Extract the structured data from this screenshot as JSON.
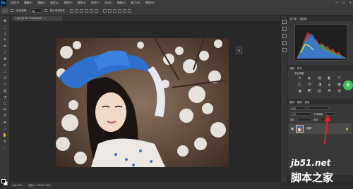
{
  "app": {
    "logo": "Ps"
  },
  "menu": {
    "items": [
      "文件(F)",
      "编辑(E)",
      "图像(I)",
      "图层(L)",
      "类型(Y)",
      "选择(S)",
      "滤镜(T)",
      "3D(D)",
      "视图(V)",
      "窗口(W)",
      "帮助(H)"
    ]
  },
  "window_controls": {
    "minimize": "—",
    "maximize": "□",
    "close": "✕"
  },
  "options_bar": {
    "auto_select_label": "自动选择:",
    "auto_select_value": "组",
    "show_transform_label": "显示变换控件"
  },
  "document_tab": {
    "title": "1.jpg @ 66.7%(RGB/8)",
    "close": "×"
  },
  "status_bar": {
    "zoom": "66.67%",
    "doc_size": "文档:1.10M/1.10M"
  },
  "float_icon": "⊞",
  "adjustments": {
    "title": "添加调整",
    "icons": [
      "☀",
      "◐",
      "▨",
      "◧",
      "▽",
      "◫",
      "⚖",
      "◨",
      "◭",
      "▦",
      "◪",
      "◩",
      "▤",
      "◓",
      "▥"
    ]
  },
  "layers": {
    "tabs": [
      "图层",
      "通道",
      "路径"
    ],
    "kind_filter": "类型",
    "blend_mode": "正常",
    "opacity_label": "不透明度",
    "lock_label": "锁定",
    "fill_label": "填充",
    "row": {
      "name": "背景",
      "eye": "◉",
      "lock": "🔒"
    }
  },
  "histogram_tabs": [
    "直方图",
    "导航器"
  ],
  "adjust_tabs": [
    "调整",
    "样式"
  ],
  "green_button": "+",
  "watermark": {
    "top": "jb51.net",
    "bottom": "脚本之家"
  }
}
